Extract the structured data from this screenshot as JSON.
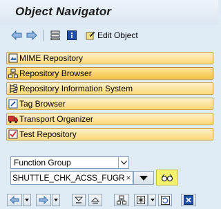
{
  "window": {
    "title": "Object Navigator"
  },
  "toolbar": {
    "back_icon": "arrow-left-icon",
    "forward_icon": "arrow-right-icon",
    "hierarchy_icon": "hierarchy-icon",
    "info_icon": "info-icon",
    "edit_object_label": "Edit Object"
  },
  "nav": {
    "items": [
      {
        "label": "MIME Repository",
        "icon": "mime-icon"
      },
      {
        "label": "Repository Browser",
        "icon": "repository-tree-icon"
      },
      {
        "label": "Repository Information System",
        "icon": "info-system-icon"
      },
      {
        "label": "Tag Browser",
        "icon": "tag-icon"
      },
      {
        "label": "Transport Organizer",
        "icon": "truck-icon"
      },
      {
        "label": "Test Repository",
        "icon": "test-icon"
      }
    ],
    "active_index": 1
  },
  "object_selector": {
    "type_value": "Function Group",
    "name_value": "SHUTTLE_CHK_ACSS_FUGR",
    "clear_symbol": "×"
  },
  "colors": {
    "background": "#dfebf5",
    "nav_item": "#fbd97a",
    "display_button": "#f4f26a"
  }
}
